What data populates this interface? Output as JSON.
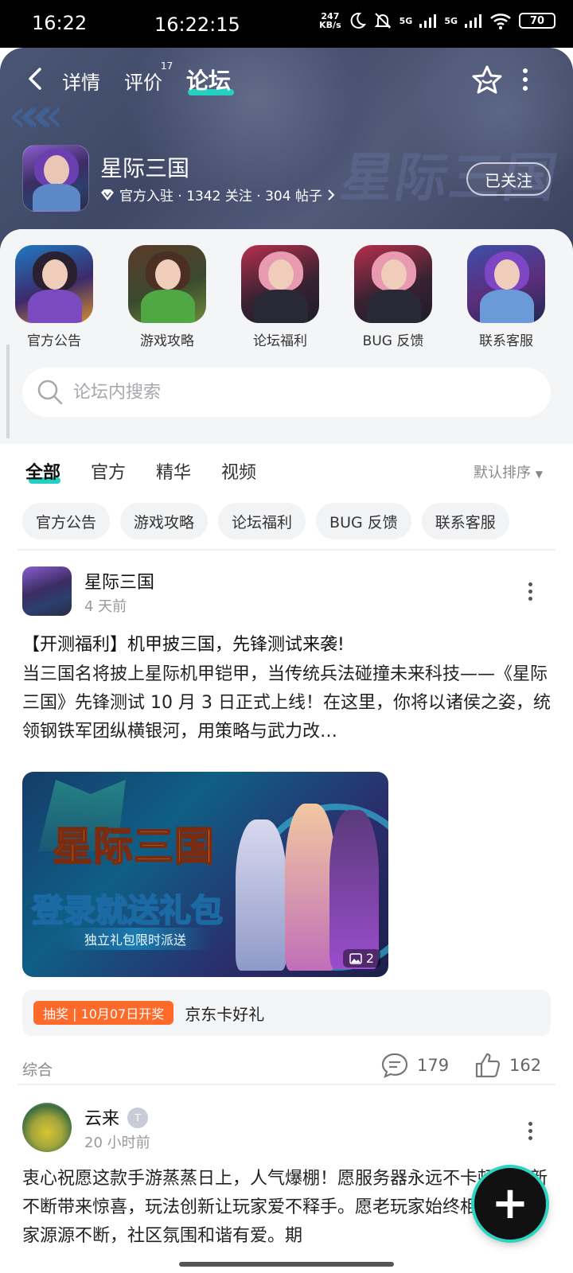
{
  "status_bar": {
    "time": "16:22",
    "clock": "16:22:15",
    "net_speed": "247",
    "net_unit": "KB/s",
    "signal1": "5G",
    "signal2": "5G",
    "battery": "70"
  },
  "header": {
    "tabs": [
      {
        "label": "详情"
      },
      {
        "label": "评价",
        "badge": "17"
      },
      {
        "label": "论坛"
      }
    ],
    "active_tab": "论坛",
    "accent_color": "#23d1c3"
  },
  "game": {
    "name": "星际三国",
    "meta": "官方入驻 · 1342 关注 · 304 帖子",
    "follow_label": "已关注",
    "watermark": "星际三国"
  },
  "categories": [
    {
      "label": "官方公告"
    },
    {
      "label": "游戏攻略"
    },
    {
      "label": "论坛福利"
    },
    {
      "label": "BUG 反馈"
    },
    {
      "label": "联系客服"
    }
  ],
  "search": {
    "placeholder": "论坛内搜索"
  },
  "filter_tabs": [
    "全部",
    "官方",
    "精华",
    "视频"
  ],
  "sort_label": "默认排序",
  "chips": [
    "官方公告",
    "游戏攻略",
    "论坛福利",
    "BUG 反馈",
    "联系客服"
  ],
  "posts": [
    {
      "author": "星际三国",
      "time": "4 天前",
      "title": "【开测福利】机甲披三国，先锋测试来袭!",
      "body": "当三国名将披上星际机甲铠甲，当传统兵法碰撞未来科技——《星际三国》先锋测试 10 月 3 日正式上线！在这里，你将以诸侯之姿，统领钢铁军团纵横银河，用策略与武力改…",
      "image": {
        "title": "星际三国",
        "subtitle": "登录就送礼包",
        "note": "独立礼包限时派送",
        "count": "2"
      },
      "lottery": {
        "tag": "抽奖 | 10月07日开奖",
        "prize": "京东卡好礼",
        "tag_color": "#ff6a2b"
      },
      "category": "综合",
      "comments": "179",
      "likes": "162"
    },
    {
      "author": "云来",
      "level": "T",
      "time": "20 小时前",
      "body": "衷心祝愿这款手游蒸蒸日上，人气爆棚！愿服务器永远不卡顿，更新不断带来惊喜，玩法创新让玩家爱不释手。愿老玩家始终相伴，新玩家源源不断，社区氛围和谐有爱。期"
    }
  ]
}
